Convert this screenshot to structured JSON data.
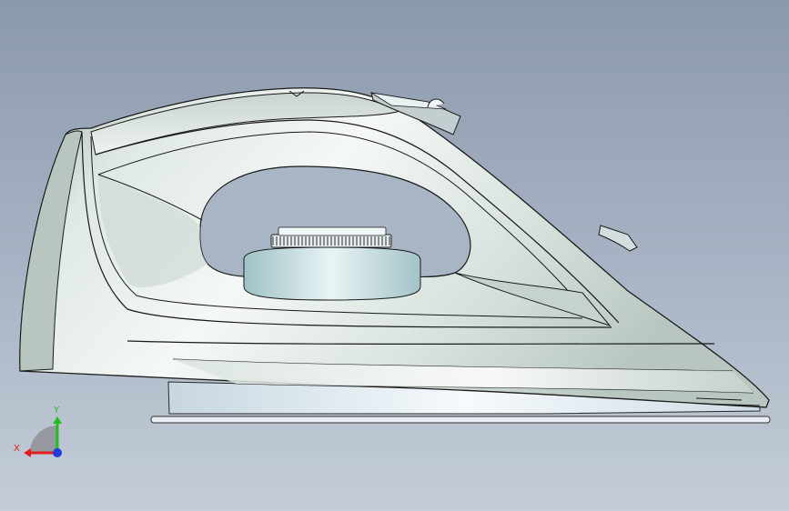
{
  "viewport": {
    "background_top": "#8b99ad",
    "background_bottom": "#c4cdd8"
  },
  "model": {
    "body_color": "#dfe8e3",
    "shadow_color": "#a9b6b0",
    "highlight_color": "#f7fbf9",
    "outline_color": "#1a1a1a"
  },
  "triad": {
    "x_label": "X",
    "y_label": "Y",
    "x_color": "#e11d1d",
    "y_color": "#1fbf1f",
    "z_color": "#1f3bdc"
  }
}
